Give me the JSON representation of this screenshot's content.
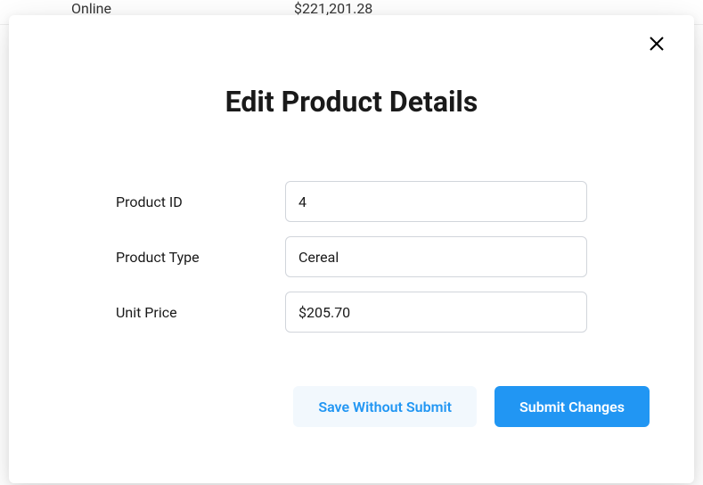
{
  "background": {
    "col1": "Online",
    "col2": "$221,201.28"
  },
  "modal": {
    "title": "Edit Product Details",
    "fields": {
      "product_id": {
        "label": "Product ID",
        "value": "4"
      },
      "product_type": {
        "label": "Product Type",
        "value": "Cereal"
      },
      "unit_price": {
        "label": "Unit Price",
        "value": "$205.70"
      }
    },
    "buttons": {
      "save": "Save Without Submit",
      "submit": "Submit Changes"
    }
  }
}
